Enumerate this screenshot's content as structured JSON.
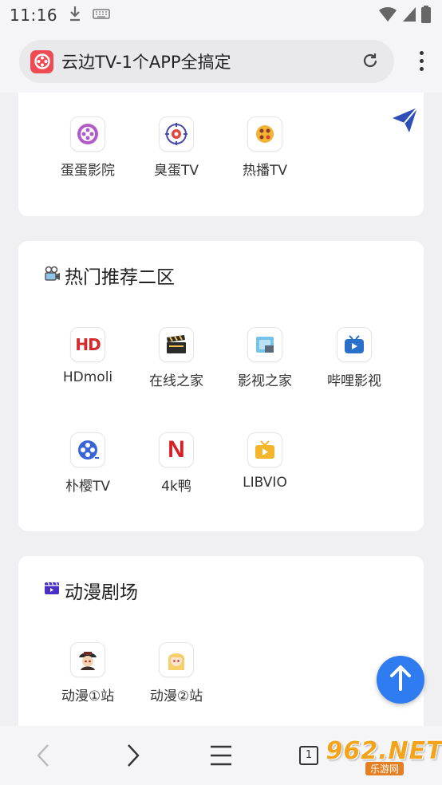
{
  "status": {
    "time": "11:16"
  },
  "browser": {
    "url_title": "云边TV-1个APP全搞定",
    "tab_count": "1"
  },
  "section1": {
    "apps": [
      {
        "label": "蛋蛋影院"
      },
      {
        "label": "臭蛋TV"
      },
      {
        "label": "热播TV"
      }
    ]
  },
  "section2": {
    "title": "热门推荐二区",
    "apps": [
      {
        "label": "HDmoli",
        "icon_text": "HD"
      },
      {
        "label": "在线之家"
      },
      {
        "label": "影视之家"
      },
      {
        "label": "哔哩影视"
      },
      {
        "label": "朴樱TV"
      },
      {
        "label": "4k鸭",
        "icon_text": "N"
      },
      {
        "label": "LIBVIO"
      }
    ]
  },
  "section3": {
    "title": "动漫剧场",
    "apps": [
      {
        "label": "动漫①站"
      },
      {
        "label": "动漫②站"
      }
    ]
  },
  "watermark": {
    "main": "962.NET",
    "sub": "乐游网"
  },
  "colors": {
    "accent": "#2f7cf0",
    "logo": "#ef4b52",
    "watermark": "#f3a31c"
  }
}
